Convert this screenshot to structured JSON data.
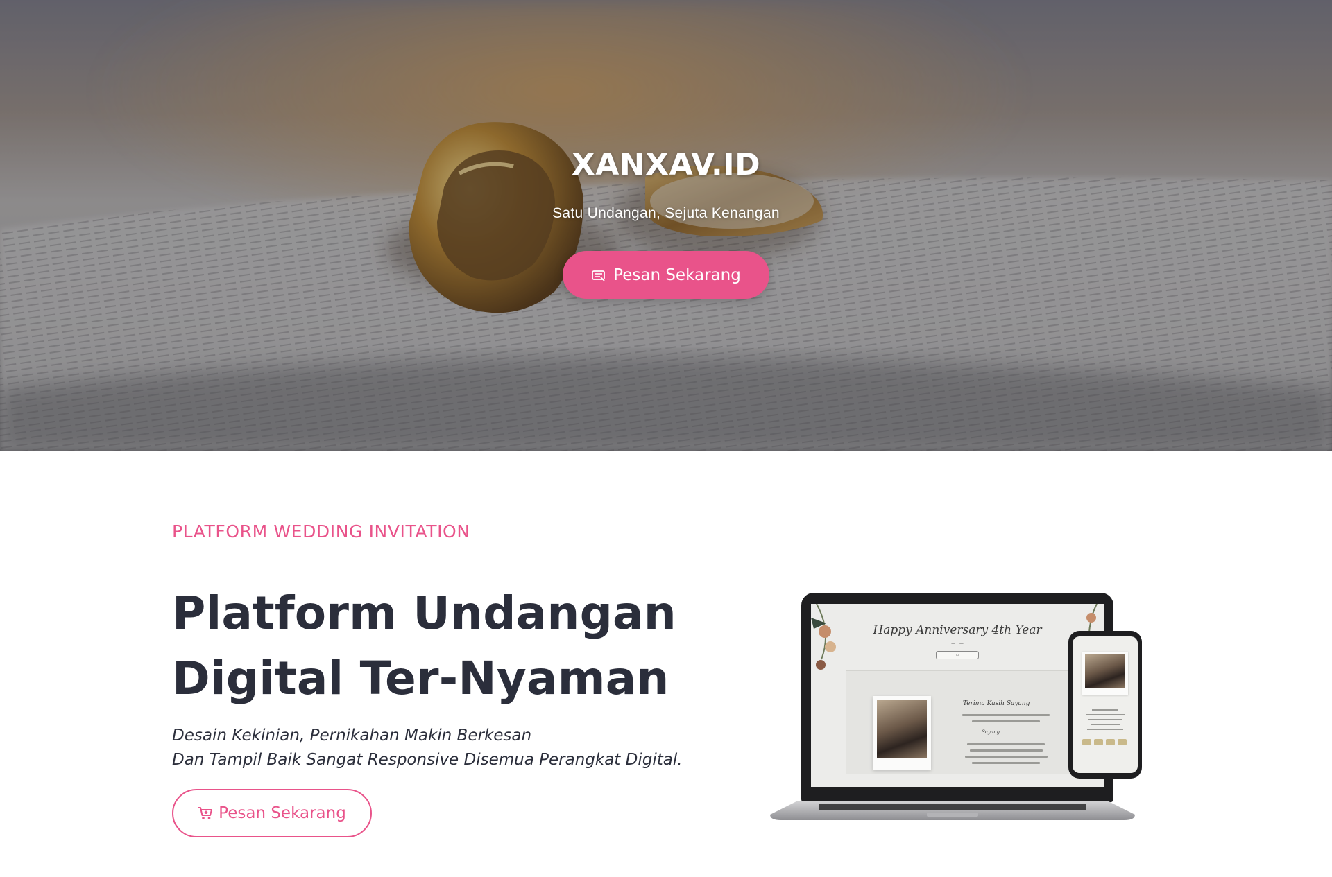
{
  "hero": {
    "title": "XANXAV.ID",
    "subtitle": "Satu Undangan, Sejuta Kenangan",
    "cta_label": "Pesan Sekarang",
    "cta_icon": "ticket-icon"
  },
  "intro": {
    "eyebrow": "PLATFORM WEDDING INVITATION",
    "headline": [
      "Platform Undangan",
      "Digital Ter-Nyaman"
    ],
    "description": [
      "Desain Kekinian, Pernikahan Makin Berkesan",
      "Dan Tampil Baik Sangat Responsive Disemua Perangkat Digital."
    ],
    "cta_label": "Pesan Sekarang",
    "cta_icon": "cart-icon"
  },
  "mockup": {
    "screen_title": "Happy Anniversary 4th Year",
    "card_title": "Terima Kasih Sayang",
    "card_sub": "Sayang"
  },
  "colors": {
    "accent": "#e9538a",
    "text_dark": "#2b2e3b",
    "white": "#ffffff"
  }
}
